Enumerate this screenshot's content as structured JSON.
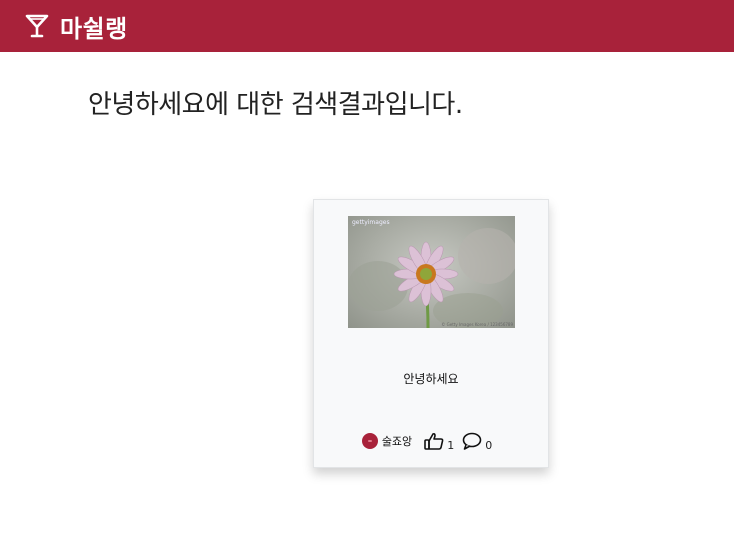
{
  "header": {
    "brand_icon": "cocktail-glass-icon",
    "brand_name": "마쉴랭",
    "bar_color": "#a8223a"
  },
  "search": {
    "result_heading": "안녕하세요에 대한 검색결과입니다."
  },
  "results": [
    {
      "image_icon": "flower-photo",
      "watermark": "gettyimages",
      "credit": "© Getty Images Korea / 123456789",
      "title": "안녕하세요",
      "author": "술죠앙",
      "likes": "1",
      "comments": "0",
      "like_icon": "thumbs-up-icon",
      "comment_icon": "speech-bubble-icon"
    }
  ]
}
